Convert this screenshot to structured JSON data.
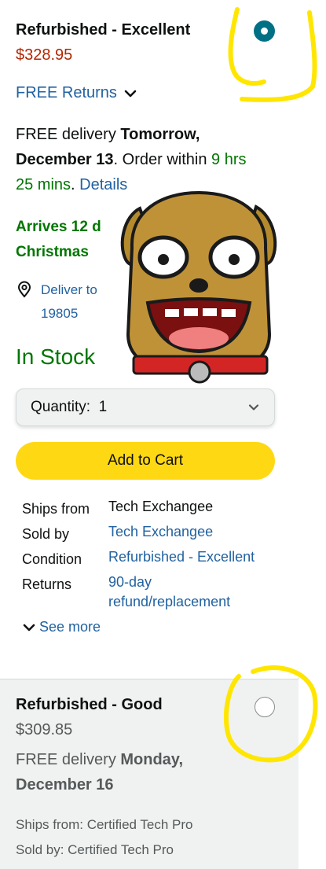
{
  "offer1": {
    "condition": "Refurbished - Excellent",
    "price": "$328.95",
    "returns_label": "FREE Returns",
    "delivery_prefix": "FREE delivery ",
    "delivery_date": "Tomorrow, December 13",
    "delivery_mid": ". Order within ",
    "delivery_countdown": "9 hrs 25 mins",
    "delivery_dot": ". ",
    "details_link": "Details",
    "arrives_line1": "Arrives 12 d",
    "arrives_line2": "Christmas",
    "deliver_to_line1": "Deliver to",
    "deliver_to_line2": "19805",
    "stock_status": "In Stock",
    "quantity_label": "Quantity:",
    "quantity_value": "1",
    "add_to_cart": "Add to Cart",
    "info": {
      "ships_from_label": "Ships from",
      "ships_from_value": "Tech Exchangee",
      "sold_by_label": "Sold by",
      "sold_by_value": "Tech Exchangee",
      "condition_label": "Condition",
      "condition_value": "Refurbished - Excellent",
      "returns_label": "Returns",
      "returns_value_line1": "90-day",
      "returns_value_line2": "refund/replacement"
    },
    "see_more": "See more"
  },
  "offer2": {
    "condition": "Refurbished - Good",
    "price": "$309.85",
    "delivery_prefix": "FREE delivery ",
    "delivery_date_line1": "Monday,",
    "delivery_date_line2": "December 16",
    "ships_from": "Ships from: Certified Tech Pro",
    "sold_by": "Sold by: Certified Tech Pro"
  },
  "colors": {
    "link": "#2162a1",
    "price": "#b12704",
    "stock": "#007600",
    "selected_radio": "#007185",
    "add_to_cart": "#ffd814",
    "annotation": "#ffe600"
  },
  "icons": [
    "chevron-down-icon",
    "location-pin-icon",
    "dog-sticker",
    "radio-selected",
    "radio-unselected"
  ]
}
